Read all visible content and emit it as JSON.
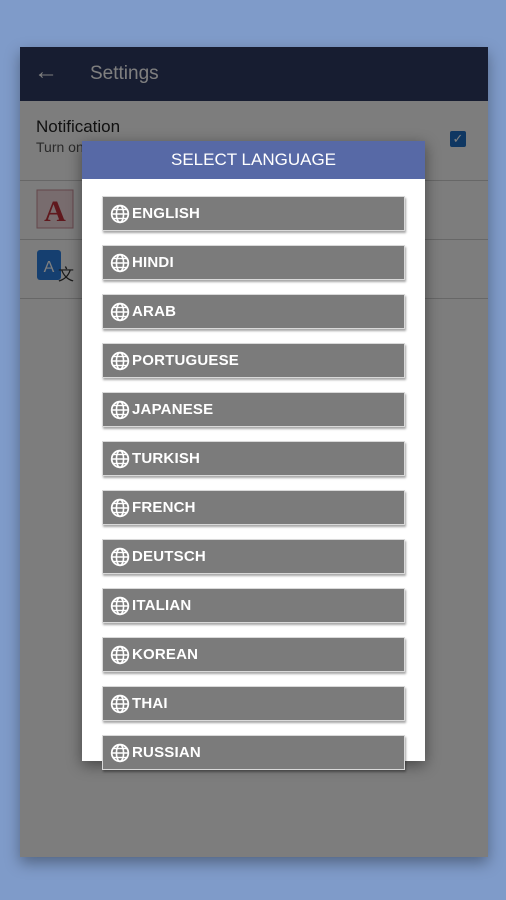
{
  "appbar": {
    "title": "Settings",
    "back_icon": "arrow-left-icon"
  },
  "settings": {
    "notification": {
      "label": "Notification",
      "sublabel": "Turn on",
      "checked": true
    },
    "items": [
      {
        "icon": "text-style-icon"
      },
      {
        "icon": "translate-icon"
      }
    ]
  },
  "dialog": {
    "title": "SELECT LANGUAGE",
    "item_icon": "globe-icon",
    "languages": [
      "ENGLISH",
      "HINDI",
      "ARAB",
      "PORTUGUESE",
      "JAPANESE",
      "TURKISH",
      "FRENCH",
      "DEUTSCH",
      "ITALIAN",
      "KOREAN",
      "THAI",
      "RUSSIAN"
    ]
  },
  "colors": {
    "background": "#7f9bc9",
    "appbar": "#2e3a63",
    "dialog_header": "#5769a6",
    "language_button": "#7b7b7b",
    "checkbox": "#1e6fc4"
  }
}
